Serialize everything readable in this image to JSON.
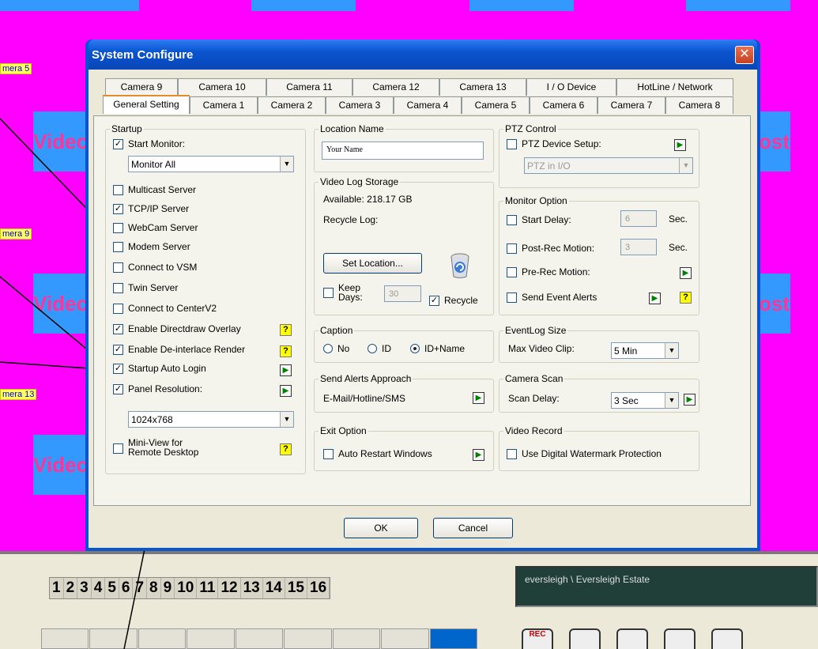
{
  "background": {
    "camera_labels": [
      "mera 5",
      "mera 9",
      "mera 13"
    ],
    "video_tiles": [
      "Videc",
      "Videc",
      "Videc"
    ],
    "right_tiles": [
      "ost",
      "ost"
    ],
    "channel_numbers": [
      "1",
      "2",
      "3",
      "4",
      "5",
      "6",
      "7",
      "8",
      "9",
      "10",
      "11",
      "12",
      "13",
      "14",
      "15",
      "16"
    ],
    "status_text": "eversleigh \\ Eversleigh Estate",
    "rec_icon_label": "REC"
  },
  "dialog": {
    "title": "System Configure",
    "close_glyph": "✕",
    "tabs_row_back": [
      "Camera 9",
      "Camera 10",
      "Camera 11",
      "Camera 12",
      "Camera 13",
      "I / O Device",
      "HotLine / Network"
    ],
    "tabs_row_front": [
      "General Setting",
      "Camera 1",
      "Camera 2",
      "Camera 3",
      "Camera 4",
      "Camera 5",
      "Camera 6",
      "Camera 7",
      "Camera 8"
    ],
    "active_tab": "General Setting",
    "startup": {
      "legend": "Startup",
      "start_monitor": "Start Monitor:",
      "monitor_select": "Monitor All",
      "items": [
        "Multicast Server",
        "TCP/IP Server",
        "WebCam Server",
        "Modem Server",
        "Connect to VSM",
        "Twin Server",
        "Connect to CenterV2",
        "Enable Directdraw Overlay",
        "Enable De-interlace Render",
        "Startup Auto Login",
        "Panel Resolution:"
      ],
      "checked": [
        false,
        true,
        false,
        false,
        false,
        false,
        false,
        true,
        true,
        true,
        true
      ],
      "resolution_select": "1024x768",
      "mini_view_line1": "Mini-View for",
      "mini_view_line2": "Remote Desktop"
    },
    "location": {
      "legend": "Location Name",
      "value": "Your Name"
    },
    "storage": {
      "legend": "Video Log Storage",
      "available": "Available: 218.17 GB",
      "recycle_log": "Recycle Log:",
      "set_location": "Set Location...",
      "keep_line1": "Keep",
      "keep_line2": "Days:",
      "keep_days": "30",
      "recycle": "Recycle"
    },
    "caption": {
      "legend": "Caption",
      "options": [
        "No",
        "ID",
        "ID+Name"
      ],
      "selected": "ID+Name"
    },
    "alerts": {
      "legend": "Send Alerts Approach",
      "text": "E-Mail/Hotline/SMS"
    },
    "exit": {
      "legend": "Exit Option",
      "auto_restart": "Auto Restart Windows"
    },
    "ptz": {
      "legend": "PTZ Control",
      "device_setup": "PTZ Device Setup:",
      "select": "PTZ in I/O"
    },
    "monitor_option": {
      "legend": "Monitor Option",
      "start_delay": "Start Delay:",
      "start_delay_value": "6",
      "post_rec": "Post-Rec Motion:",
      "post_rec_value": "3",
      "sec": "Sec.",
      "pre_rec": "Pre-Rec Motion:",
      "send_event": "Send Event Alerts"
    },
    "eventlog": {
      "legend": "EventLog Size",
      "max_clip": "Max Video Clip:",
      "max_clip_value": "5 Min"
    },
    "camera_scan": {
      "legend": "Camera Scan",
      "scan_delay": "Scan Delay:",
      "scan_value": "3 Sec"
    },
    "video_record": {
      "legend": "Video Record",
      "watermark": "Use Digital Watermark Protection"
    },
    "ok": "OK",
    "cancel": "Cancel",
    "glyphs": {
      "arrow": "▶",
      "help": "?",
      "check": "✓",
      "dropdown": "▼"
    }
  }
}
